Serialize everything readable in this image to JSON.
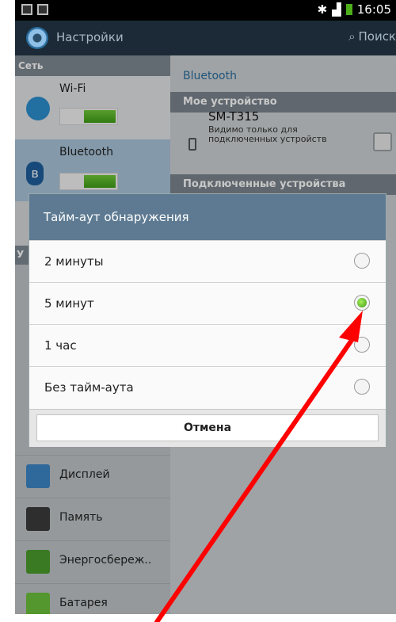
{
  "status_bar": {
    "time": "16:05"
  },
  "action_bar": {
    "title": "Настройки",
    "search_label": "Поиск"
  },
  "left_pane": {
    "section_header": "Сеть",
    "section_header_partial": "У",
    "wifi_label": "Wi-Fi",
    "bluetooth_label": "Bluetooth",
    "menu": [
      {
        "label": "Дисплей",
        "icon": "display-icon"
      },
      {
        "label": "Память",
        "icon": "memory-icon"
      },
      {
        "label": "Энергосбереж..",
        "icon": "power-saving-icon"
      },
      {
        "label": "Батарея",
        "icon": "battery-icon"
      }
    ]
  },
  "right_pane": {
    "title": "Bluetooth",
    "my_device_header": "Мое устройство",
    "device_name": "SM-T315",
    "device_visibility": "Видимо только для подключенных устройств",
    "connected_header": "Подключенные устройства"
  },
  "dialog": {
    "title": "Тайм-аут обнаружения",
    "options": [
      {
        "label": "2 минуты",
        "selected": false
      },
      {
        "label": "5 минут",
        "selected": true
      },
      {
        "label": "1 час",
        "selected": false
      },
      {
        "label": "Без тайм-аута",
        "selected": false
      }
    ],
    "cancel_label": "Отмена"
  },
  "annotation": {
    "color": "#ff0000"
  }
}
